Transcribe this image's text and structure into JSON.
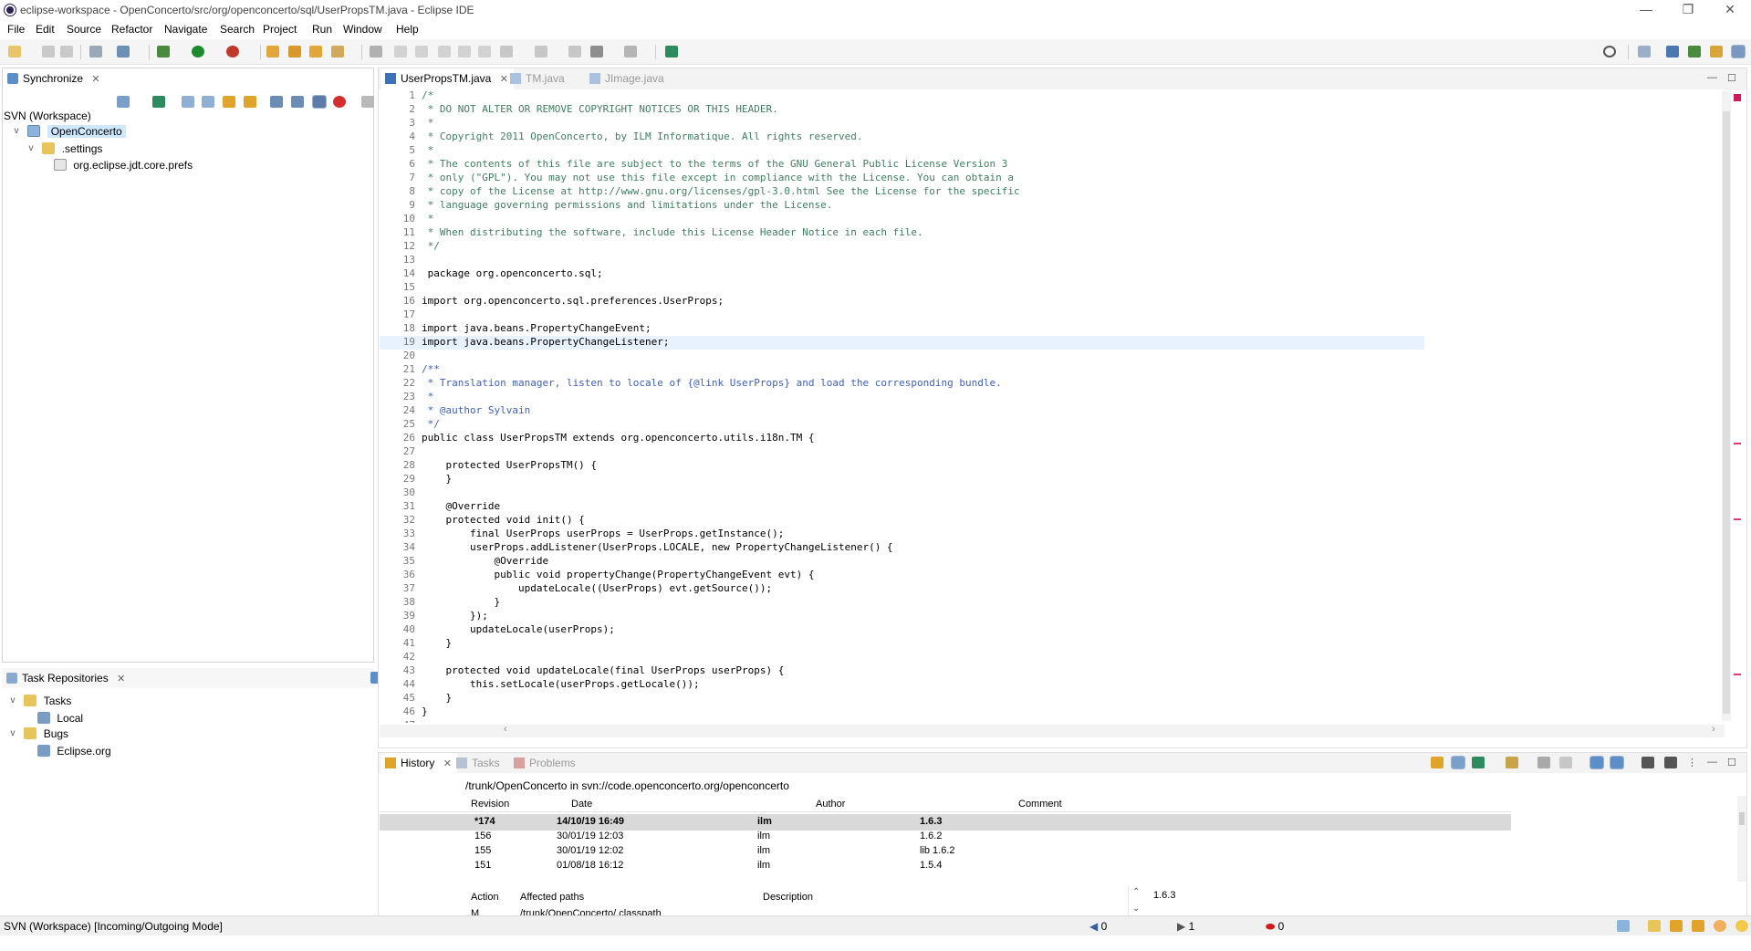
{
  "window": {
    "title": "eclipse-workspace - OpenConcerto/src/org/openconcerto/sql/UserPropsTM.java - Eclipse IDE",
    "controls": [
      "—",
      "❐",
      "✕"
    ]
  },
  "menu": [
    "File",
    "Edit",
    "Source",
    "Refactor",
    "Navigate",
    "Search",
    "Project",
    "Run",
    "Window",
    "Help"
  ],
  "synchronize": {
    "tab_label": "Synchronize",
    "root_label": "SVN (Workspace)",
    "tree": [
      "OpenConcerto",
      ".settings",
      "org.eclipse.jdt.core.prefs"
    ]
  },
  "task_repositories": {
    "tab_label": "Task Repositories",
    "tree": [
      "Tasks",
      "Local",
      "Bugs",
      "Eclipse.org"
    ]
  },
  "editor": {
    "tabs": [
      "UserPropsTM.java",
      "TM.java",
      "JImage.java"
    ],
    "lines": [
      "/*",
      " * DO NOT ALTER OR REMOVE COPYRIGHT NOTICES OR THIS HEADER.",
      " *",
      " * Copyright 2011 OpenConcerto, by ILM Informatique. All rights reserved.",
      " *",
      " * The contents of this file are subject to the terms of the GNU General Public License Version 3",
      " * only (\"GPL\"). You may not use this file except in compliance with the License. You can obtain a",
      " * copy of the License at http://www.gnu.org/licenses/gpl-3.0.html See the License for the specific",
      " * language governing permissions and limitations under the License.",
      " *",
      " * When distributing the software, include this License Header Notice in each file.",
      " */",
      "",
      " package org.openconcerto.sql;",
      "",
      "import org.openconcerto.sql.preferences.UserProps;",
      "",
      "import java.beans.PropertyChangeEvent;",
      "import java.beans.PropertyChangeListener;",
      "",
      "/**",
      " * Translation manager, listen to locale of {@link UserProps} and load the corresponding bundle.",
      " *",
      " * @author Sylvain",
      " */",
      "public class UserPropsTM extends org.openconcerto.utils.i18n.TM {",
      "",
      "    protected UserPropsTM() {",
      "    }",
      "",
      "    @Override",
      "    protected void init() {",
      "        final UserProps userProps = UserProps.getInstance();",
      "        userProps.addListener(UserProps.LOCALE, new PropertyChangeListener() {",
      "            @Override",
      "            public void propertyChange(PropertyChangeEvent evt) {",
      "                updateLocale((UserProps) evt.getSource());",
      "            }",
      "        });",
      "        updateLocale(userProps);",
      "    }",
      "",
      "    protected void updateLocale(final UserProps userProps) {",
      "        this.setLocale(userProps.getLocale());",
      "    }",
      "}",
      ""
    ]
  },
  "bottom": {
    "tabs": [
      "History",
      "Tasks",
      "Problems"
    ],
    "path": "/trunk/OpenConcerto in svn://code.openconcerto.org/openconcerto",
    "columns": [
      "Revision",
      "Date",
      "Author",
      "Comment"
    ],
    "rows": [
      [
        "*174",
        "14/10/19 16:49",
        "ilm",
        "1.6.3"
      ],
      [
        "156",
        "30/01/19 12:03",
        "ilm",
        "1.6.2"
      ],
      [
        "155",
        "30/01/19 12:02",
        "ilm",
        "lib 1.6.2"
      ],
      [
        "151",
        "01/08/18 16:12",
        "ilm",
        "1.5.4"
      ]
    ],
    "affected_columns": [
      "Action",
      "Affected paths",
      "Description"
    ],
    "affected_rows": [
      [
        "M",
        "/trunk/OpenConcerto/.classpath"
      ]
    ],
    "comment_detail": "1.6.3"
  },
  "status": {
    "mode": "SVN (Workspace) [Incoming/Outgoing Mode]",
    "incoming": "0",
    "outgoing": "1",
    "conflicts": "0"
  }
}
